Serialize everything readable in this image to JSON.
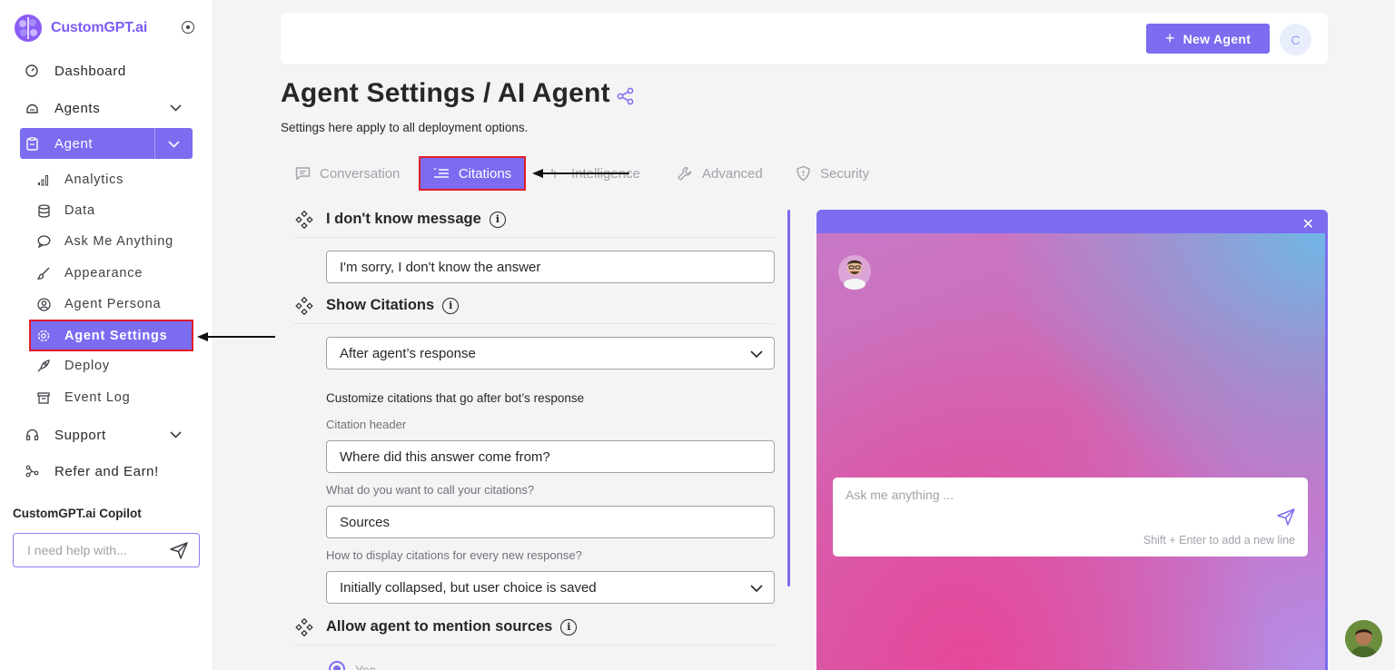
{
  "brand": {
    "name": "CustomGPT.ai",
    "logo_color": "#7c5cf5",
    "accent": "#7b6cf0"
  },
  "sidebar": {
    "items": [
      {
        "label": "Dashboard",
        "icon": "gauge-icon"
      },
      {
        "label": "Agents",
        "icon": "robot-icon"
      },
      {
        "label": "Agent",
        "icon": "clipboard-icon"
      },
      {
        "label": "Support",
        "icon": "headset-icon"
      },
      {
        "label": "Refer and Earn!",
        "icon": "share-network-icon"
      }
    ],
    "sub_items": [
      {
        "label": "Analytics",
        "icon": "bar-chart-icon"
      },
      {
        "label": "Data",
        "icon": "database-icon"
      },
      {
        "label": "Ask Me Anything",
        "icon": "chat-bubble-icon"
      },
      {
        "label": "Appearance",
        "icon": "brush-icon"
      },
      {
        "label": "Agent Persona",
        "icon": "user-circle-icon"
      },
      {
        "label": "Agent Settings",
        "icon": "gear-icon"
      },
      {
        "label": "Deploy",
        "icon": "rocket-icon"
      },
      {
        "label": "Event Log",
        "icon": "archive-icon"
      }
    ],
    "active_sub_item": "Agent Settings",
    "copilot": {
      "title": "CustomGPT.ai Copilot",
      "placeholder": "I need help with..."
    }
  },
  "topbar": {
    "new_agent_label": "New Agent",
    "avatar_initial": "C"
  },
  "page": {
    "title": "Agent Settings / AI Agent",
    "subtitle": "Settings here apply to all deployment options."
  },
  "tabs": [
    {
      "label": "Conversation",
      "icon": "message-square-icon"
    },
    {
      "label": "Citations",
      "icon": "citations-icon",
      "active": true
    },
    {
      "label": "Intelligence",
      "icon": "sparkle-icon"
    },
    {
      "label": "Advanced",
      "icon": "wrench-icon"
    },
    {
      "label": "Security",
      "icon": "shield-icon"
    }
  ],
  "settings": {
    "idk": {
      "title": "I don't know message",
      "value": "I'm sorry, I don't know the answer"
    },
    "show_citations": {
      "title": "Show Citations",
      "selected": "After agent’s response"
    },
    "customize_text": "Customize citations that go after bot’s response",
    "citation_header": {
      "label": "Citation header",
      "value": "Where did this answer come from?"
    },
    "citation_name": {
      "label": "What do you want to call your citations?",
      "value": "Sources"
    },
    "display_mode": {
      "label": "How to display citations for every new response?",
      "selected": "Initially collapsed, but user choice is saved"
    },
    "mention_sources": {
      "title": "Allow agent to mention sources",
      "option_yes": "Yes"
    }
  },
  "preview": {
    "placeholder": "Ask me anything ...",
    "hint": "Shift + Enter to add a new line",
    "close_symbol": "✕"
  }
}
